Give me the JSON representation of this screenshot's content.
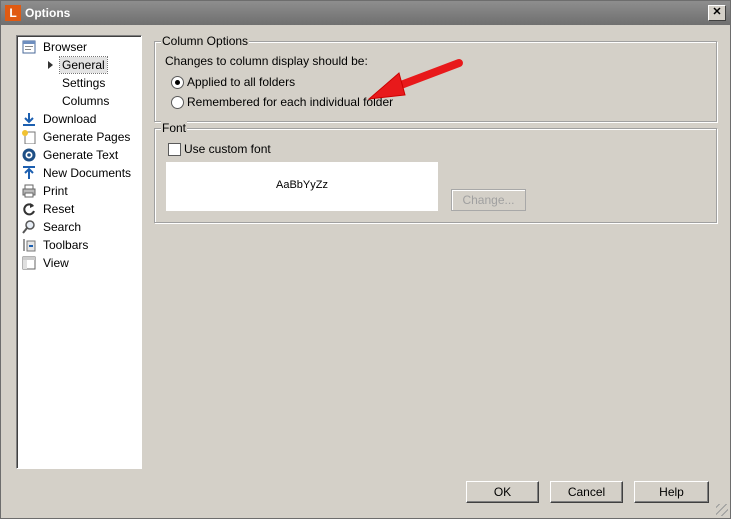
{
  "window": {
    "title": "Options",
    "app_icon_letter": "L",
    "close_glyph": "✕"
  },
  "sidebar": {
    "items": [
      {
        "label": "Browser",
        "icon": "browser-icon"
      },
      {
        "label": "General",
        "icon": "expand-arrow-icon"
      },
      {
        "label": "Settings"
      },
      {
        "label": "Columns"
      },
      {
        "label": "Download",
        "icon": "download-icon"
      },
      {
        "label": "Generate Pages",
        "icon": "generate-pages-icon"
      },
      {
        "label": "Generate Text",
        "icon": "generate-text-icon"
      },
      {
        "label": "New Documents",
        "icon": "new-documents-icon"
      },
      {
        "label": "Print",
        "icon": "print-icon"
      },
      {
        "label": "Reset",
        "icon": "reset-icon"
      },
      {
        "label": "Search",
        "icon": "search-icon"
      },
      {
        "label": "Toolbars",
        "icon": "toolbars-icon"
      },
      {
        "label": "View",
        "icon": "view-icon"
      }
    ],
    "selected": "General"
  },
  "column_options": {
    "legend": "Column Options",
    "prompt": "Changes to column display should be:",
    "options": [
      {
        "label": "Applied to all folders",
        "checked": true
      },
      {
        "label": "Remembered for each individual folder",
        "checked": false
      }
    ]
  },
  "font": {
    "legend": "Font",
    "custom_font_label": "Use custom font",
    "custom_font_checked": false,
    "preview_text": "AaBbYyZz",
    "change_label": "Change..."
  },
  "buttons": {
    "ok": "OK",
    "cancel": "Cancel",
    "help": "Help"
  },
  "annotation": {
    "color": "#e8191b"
  }
}
